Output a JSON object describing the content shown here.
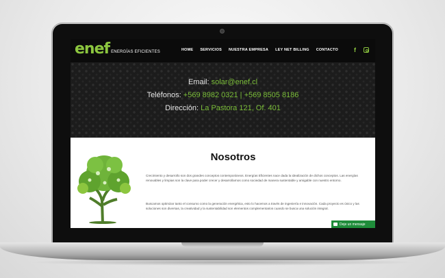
{
  "site": {
    "logo": {
      "mark": "enef",
      "subtitle": "ENERGÍAS EFICIENTES"
    },
    "nav": [
      "HOME",
      "SERVICIOS",
      "NUESTRA EMPRESA",
      "LEY NET BILLING",
      "CONTACTO"
    ],
    "social": {
      "facebook": "f"
    },
    "hero": {
      "email_label": "Email:",
      "email_value": "solar@enef.cl",
      "phone_label": "Teléfonos:",
      "phone_value": "+569 8982 0321 | +569 8505 8186",
      "address_label": "Dirección:",
      "address_value": "La Pastora 121, Of. 401"
    },
    "section": {
      "title": "Nosotros",
      "paragraph1": "Crecimiento y desarrollo son dos grandes conceptos contemporáneos. Energías Eficientes nace dada la idealización de dichos conceptos. Las energías renovables y limpias son la clave para poder crecer y desarrollarnos como sociedad de manera sustentable y amigable con nuestro entorno.",
      "paragraph2": "Buscamos optimizar tanto el consumo como la generación energética, esto lo hacemos a través de ingeniería e innovación. Cada proyecto es único y las soluciones son diversas, la creatividad y la sustentabilidad son elementos complementarios cuando se busca una solución integral."
    },
    "chat_label": "Deje un mensaje"
  },
  "colors": {
    "accent": "#8cc63f",
    "nav_bg": "#0b0b0b",
    "chat": "#1f8c3a"
  }
}
